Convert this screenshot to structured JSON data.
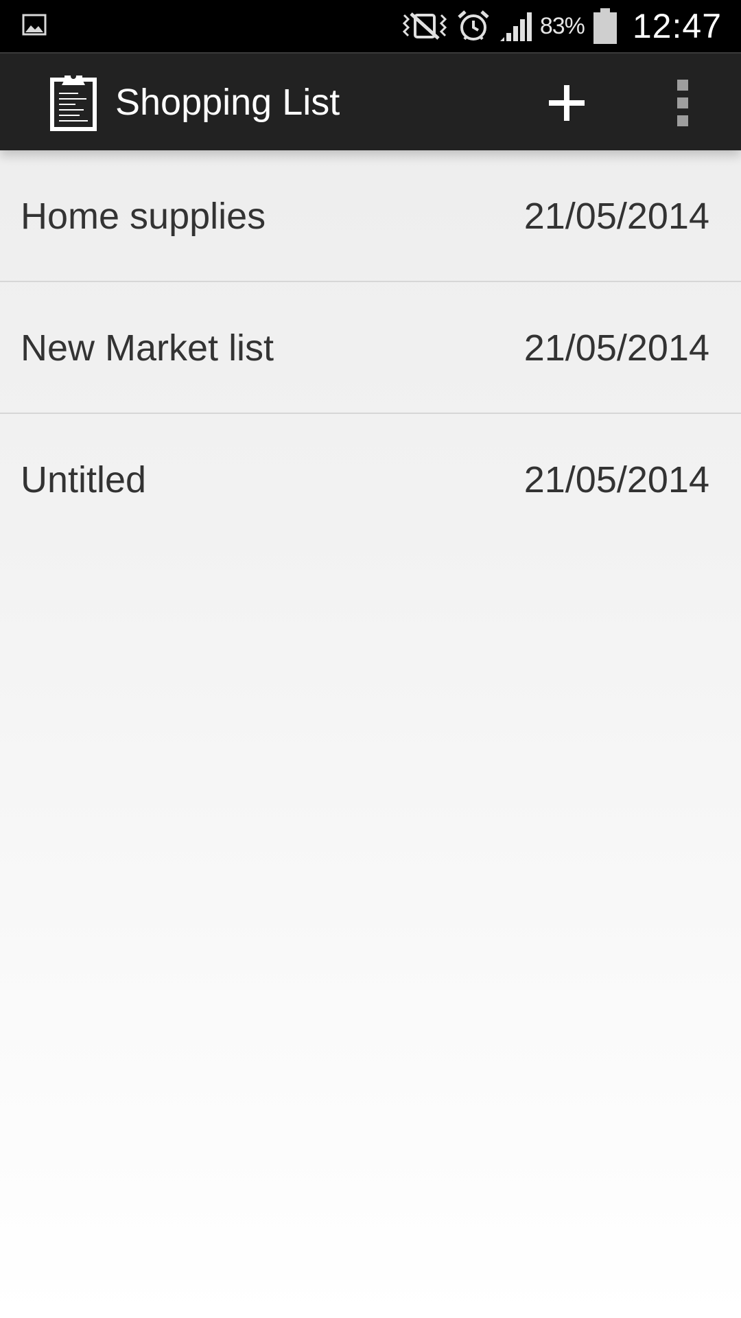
{
  "status_bar": {
    "battery_percent": "83%",
    "time": "12:47",
    "icons": [
      "picture-icon",
      "silent-vibrate-icon",
      "alarm-icon",
      "signal-icon",
      "battery-icon"
    ]
  },
  "action_bar": {
    "title": "Shopping List",
    "app_icon": "clipboard-icon",
    "add_icon": "plus-icon",
    "overflow_icon": "overflow-menu-icon"
  },
  "lists": [
    {
      "name": "Home supplies",
      "date": "21/05/2014"
    },
    {
      "name": "New Market list",
      "date": "21/05/2014"
    },
    {
      "name": "Untitled",
      "date": "21/05/2014"
    }
  ],
  "colors": {
    "status_bar_bg": "#000000",
    "action_bar_bg": "#222222",
    "text_primary": "#333333",
    "divider": "#d6d6d6"
  }
}
